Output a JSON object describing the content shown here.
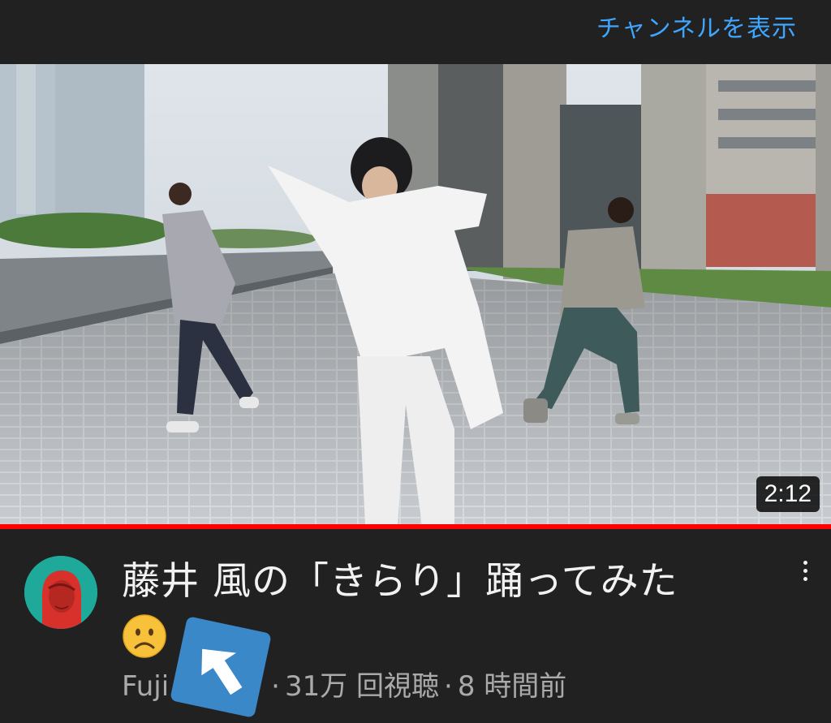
{
  "header": {
    "view_channel_label": "チャンネルを表示"
  },
  "video": {
    "duration": "2:12",
    "progress_fraction": 1.0,
    "title": "藤井 風の「きらり」踊ってみた",
    "emoji": "frowning-face",
    "channel_name_visible": "Fuji",
    "separator": "·",
    "views": "31万 回視聴",
    "age": "8 時間前"
  },
  "colors": {
    "accent_blue": "#3ea6ff",
    "progress_red": "#ff0000",
    "overlay_blue": "#3b88c9"
  },
  "icons": [
    "more-vert-icon",
    "back-arrow-icon",
    "channel-avatar"
  ]
}
